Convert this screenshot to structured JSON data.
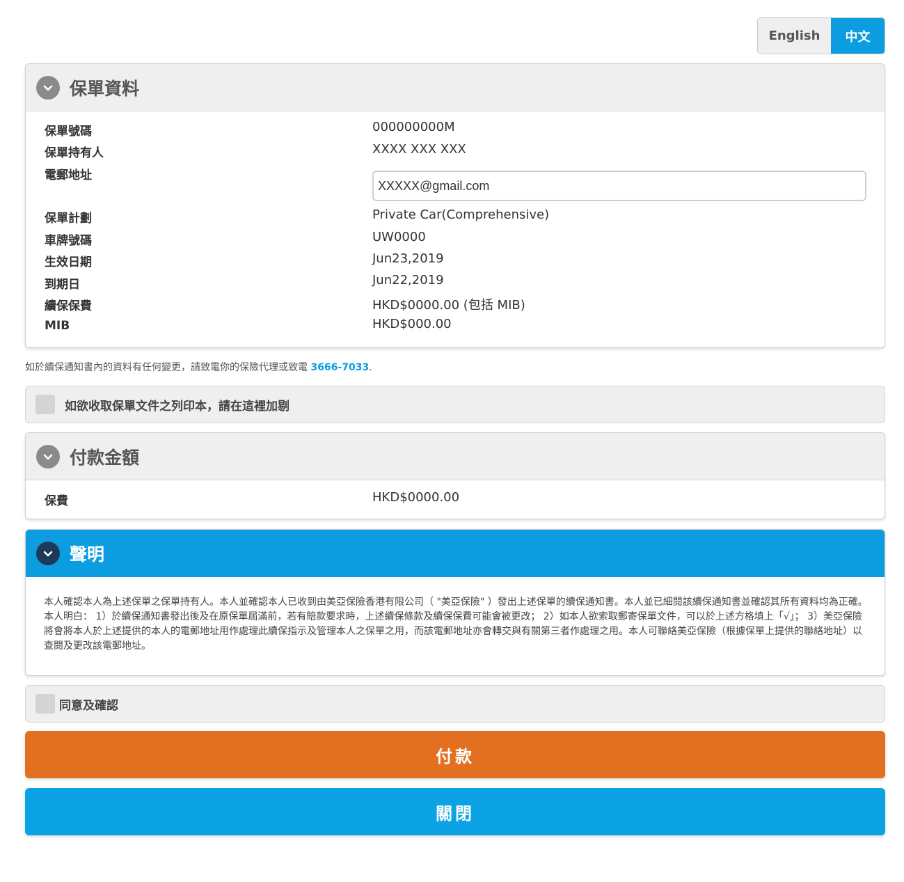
{
  "language": {
    "english": "English",
    "chinese": "中文"
  },
  "policy_info": {
    "title": "保單資料",
    "fields": {
      "policy_no_label": "保單號碼",
      "policy_no": "000000000M",
      "holder_label": "保單持有人",
      "holder": "XXXX XXX XXX",
      "email_label": "電郵地址",
      "email": "XXXXX@gmail.com",
      "plan_label": "保單計劃",
      "plan": "Private Car(Comprehensive)",
      "plate_label": "車牌號碼",
      "plate": "UW0000",
      "effective_label": "生效日期",
      "effective": "Jun23,2019",
      "expiry_label": "到期日",
      "expiry": "Jun22,2019",
      "premium_label": "續保保費",
      "premium": "HKD$0000.00 (包括 MIB)",
      "mib_label": "MIB",
      "mib": "HKD$000.00"
    }
  },
  "notice": {
    "text": "如於續保通知書內的資料有任何變更，請致電你的保險代理或致電 ",
    "phone": "3666-7033",
    "suffix": "."
  },
  "print_copy": {
    "label": "如欲收取保單文件之列印本，請在這裡加剔"
  },
  "payment": {
    "title": "付款金額",
    "premium_label": "保費",
    "premium": "HKD$0000.00"
  },
  "declaration": {
    "title": "聲明",
    "text": "本人確認本人為上述保單之保單持有人。本人並確認本人已收到由美亞保險香港有限公司（ \"美亞保險\" ）發出上述保單的續保通知書。本人並已細閱該續保通知書並確認其所有資料均為正確。本人明白： 1）於續保通知書發出後及在原保單屆滿前，若有賠款要求時，上述續保條款及續保保費可能會被更改； 2）如本人欲索取郵寄保單文件，可以於上述方格填上「√」； 3）美亞保險將會將本人於上述提供的本人的電郵地址用作處理此續保指示及管理本人之保單之用，而該電郵地址亦會轉交與有關第三者作處理之用。本人可聯絡美亞保險（根據保單上提供的聯絡地址）以查閱及更改該電郵地址。"
  },
  "agree": {
    "label": "同意及確認"
  },
  "buttons": {
    "pay": "付款",
    "close": "關閉"
  }
}
